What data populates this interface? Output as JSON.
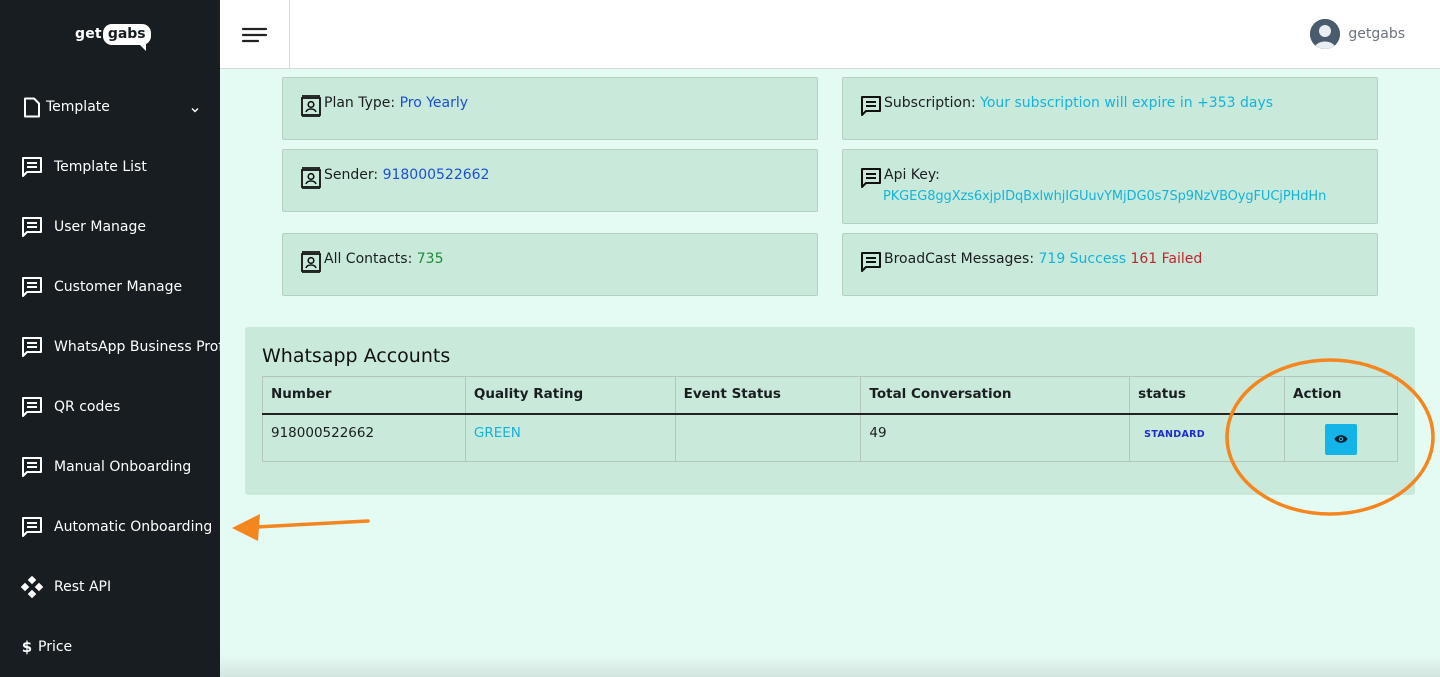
{
  "brand": {
    "logo_part1": "get",
    "logo_part2": "gabs"
  },
  "sidebar": {
    "items": [
      {
        "label": "Template",
        "icon": "document-icon"
      },
      {
        "label": "Template List",
        "icon": "message-icon"
      },
      {
        "label": "User Manage",
        "icon": "message-icon"
      },
      {
        "label": "Customer Manage",
        "icon": "message-icon"
      },
      {
        "label": "WhatsApp Business Prof",
        "icon": "message-icon"
      },
      {
        "label": "QR codes",
        "icon": "message-icon"
      },
      {
        "label": "Manual Onboarding",
        "icon": "message-icon"
      },
      {
        "label": "Automatic Onboarding",
        "icon": "message-icon"
      },
      {
        "label": "Rest API",
        "icon": "api-icon"
      },
      {
        "label": "Price",
        "icon": "dollar-icon"
      }
    ]
  },
  "header": {
    "user_name": "getgabs"
  },
  "cards": {
    "plan_label": "Plan Type:",
    "plan_value": "Pro Yearly",
    "subscription_label": "Subscription:",
    "subscription_value": "Your subscription will expire in +353 days",
    "sender_label": "Sender:",
    "sender_value": "918000522662",
    "api_label": "Api Key:",
    "api_value": "PKGEG8ggXzs6xjpIDqBxlwhjIGUuvYMjDG0s7Sp9NzVBOygFUCjPHdHn",
    "contacts_label": "All Contacts:",
    "contacts_value": "735",
    "broadcast_label": "BroadCast Messages:",
    "broadcast_success": "719 Success",
    "broadcast_failed": "161 Failed"
  },
  "accounts": {
    "title": "Whatsapp Accounts",
    "columns": [
      "Number",
      "Quality Rating",
      "Event Status",
      "Total Conversation",
      "status",
      "Action"
    ],
    "rows": [
      {
        "number": "918000522662",
        "quality": "GREEN",
        "event_status": "",
        "total_conversation": "49",
        "status": "STANDARD"
      }
    ]
  },
  "colors": {
    "sidebar_bg": "#171d21",
    "page_bg": "#e4fbf3",
    "card_bg": "#c9eadb",
    "accent_cyan": "#14b3dc",
    "annotation_orange": "#f5861f"
  }
}
